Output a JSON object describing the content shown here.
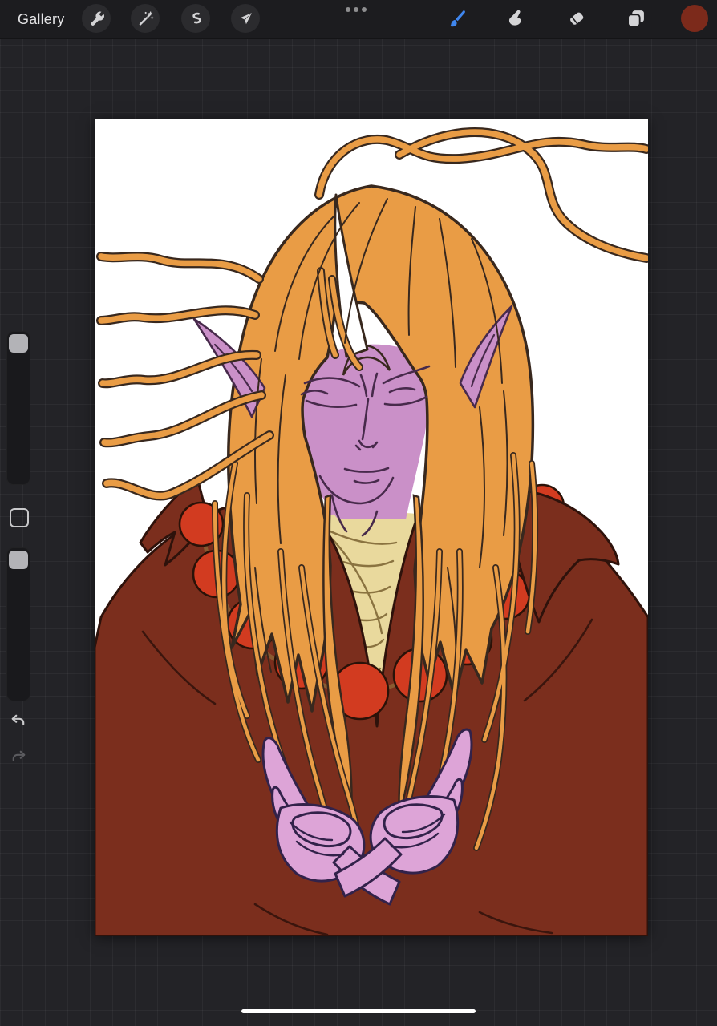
{
  "topbar": {
    "gallery_label": "Gallery",
    "tools_left": [
      {
        "id": "actions",
        "icon": "wrench-icon"
      },
      {
        "id": "adjustments",
        "icon": "magic-wand-icon"
      },
      {
        "id": "selection",
        "icon": "selection-s-icon"
      },
      {
        "id": "transform",
        "icon": "transform-arrow-icon"
      }
    ],
    "overflow_icon": "ellipsis-icon",
    "tools_right": [
      {
        "id": "paint",
        "icon": "brush-icon",
        "active": true
      },
      {
        "id": "smudge",
        "icon": "smudge-finger-icon",
        "active": false
      },
      {
        "id": "erase",
        "icon": "eraser-icon",
        "active": false
      },
      {
        "id": "layers",
        "icon": "layers-icon",
        "active": false
      },
      {
        "id": "color",
        "icon": "color-swatch",
        "active": false
      }
    ],
    "colors": {
      "bar_bg": "#1c1c1f",
      "button_bg": "#2b2b2e",
      "icon": "#d4d4d6",
      "active_tool_blue": "#3f86ee",
      "color_swatch": "#7c2a1b",
      "dots": "#8e8e90"
    }
  },
  "sidebar": {
    "controls": [
      "brush-size-slider",
      "modify-button",
      "opacity-slider",
      "undo-button",
      "redo-button"
    ],
    "colors": {
      "track": "#19191c",
      "handle": "#b3b3b7",
      "undo_icon": "#c9c9cb",
      "redo_icon": "#5b5b5f"
    }
  },
  "canvas": {
    "paper": "#ffffff",
    "art": {
      "hair": "#e99c45",
      "hairLine": "#38281e",
      "skin": "#ca90c8",
      "skinLine": "#472a4b",
      "hand": "#dda4d7",
      "robe": "#7b2e1d",
      "robeLine": "#2e120b",
      "shirt": "#e9d99d",
      "shirtLine": "#8a7340",
      "bead": "#d23b20",
      "beadLine": "#2a1208",
      "horn": "#ffffff",
      "string": "#8a5a30"
    }
  },
  "home_indicator": {
    "color": "#ffffff"
  },
  "background": {
    "color": "#232327",
    "grid_line": "rgba(255,255,255,0.045)"
  }
}
